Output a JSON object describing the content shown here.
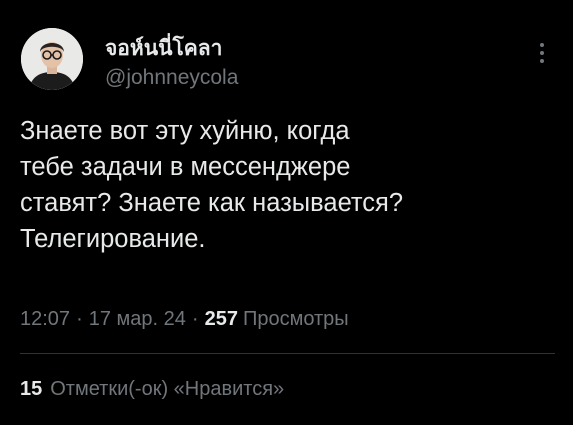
{
  "author": {
    "display_name": "จอห์นนี่โคลา",
    "handle": "@johnneycola",
    "avatar_icon": "person-with-glasses-avatar"
  },
  "menu": {
    "icon": "more-vertical-icon"
  },
  "tweet": {
    "text_lines": [
      "Знаете вот эту хуйню, когда",
      "тебе задачи в мессенджере",
      "ставят? Знаете как называется?",
      "Телегирование."
    ],
    "time": "12:07",
    "date": "17 мар. 24",
    "separator": "·",
    "views_count": "257",
    "views_label": "Просмотры"
  },
  "engagement": {
    "likes_count": "15",
    "likes_label": "Отметки(-ок) «Нравится»"
  },
  "colors": {
    "background": "#000000",
    "primary_text": "#e7e9ea",
    "secondary_text": "#71767b",
    "divider": "#2f3336"
  }
}
